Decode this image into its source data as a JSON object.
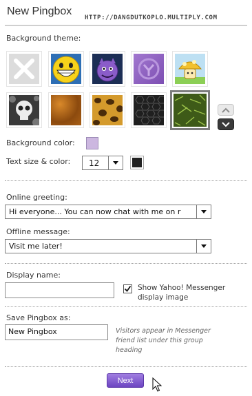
{
  "header": {
    "title": "New Pingbox",
    "watermark": "HTTP://DANGDUTKOPLO.MULTIPLY.COM"
  },
  "theme": {
    "label": "Background theme:",
    "themes": [
      {
        "name": "none",
        "selected": false
      },
      {
        "name": "grinning-smiley",
        "selected": false
      },
      {
        "name": "purple-devil",
        "selected": false
      },
      {
        "name": "purple-yahoo",
        "selected": false
      },
      {
        "name": "mushroom",
        "selected": false
      },
      {
        "name": "skulls",
        "selected": false
      },
      {
        "name": "orange-texture",
        "selected": false
      },
      {
        "name": "leopard",
        "selected": false
      },
      {
        "name": "hex-mesh",
        "selected": false
      },
      {
        "name": "grass",
        "selected": true
      }
    ]
  },
  "background_color": {
    "label": "Background color:",
    "value": "#ccb7e0"
  },
  "text": {
    "label": "Text size & color:",
    "size": "12",
    "color": "#222222"
  },
  "online_greeting": {
    "label": "Online greeting:",
    "value": "Hi everyone... You can now chat with me on r"
  },
  "offline_message": {
    "label": "Offline message:",
    "value": "Visit me later!"
  },
  "display_name": {
    "label": "Display name:",
    "value": "",
    "checkbox_checked": true,
    "checkbox_label_line1": "Show Yahoo! Messenger",
    "checkbox_label_line2": "display image"
  },
  "save_as": {
    "label": "Save Pingbox as:",
    "value": "New Pingbox",
    "hint_line1": "Visitors appear in Messenger",
    "hint_line2": "friend list under this group",
    "hint_line3": "heading"
  },
  "actions": {
    "next_label": "Next"
  }
}
